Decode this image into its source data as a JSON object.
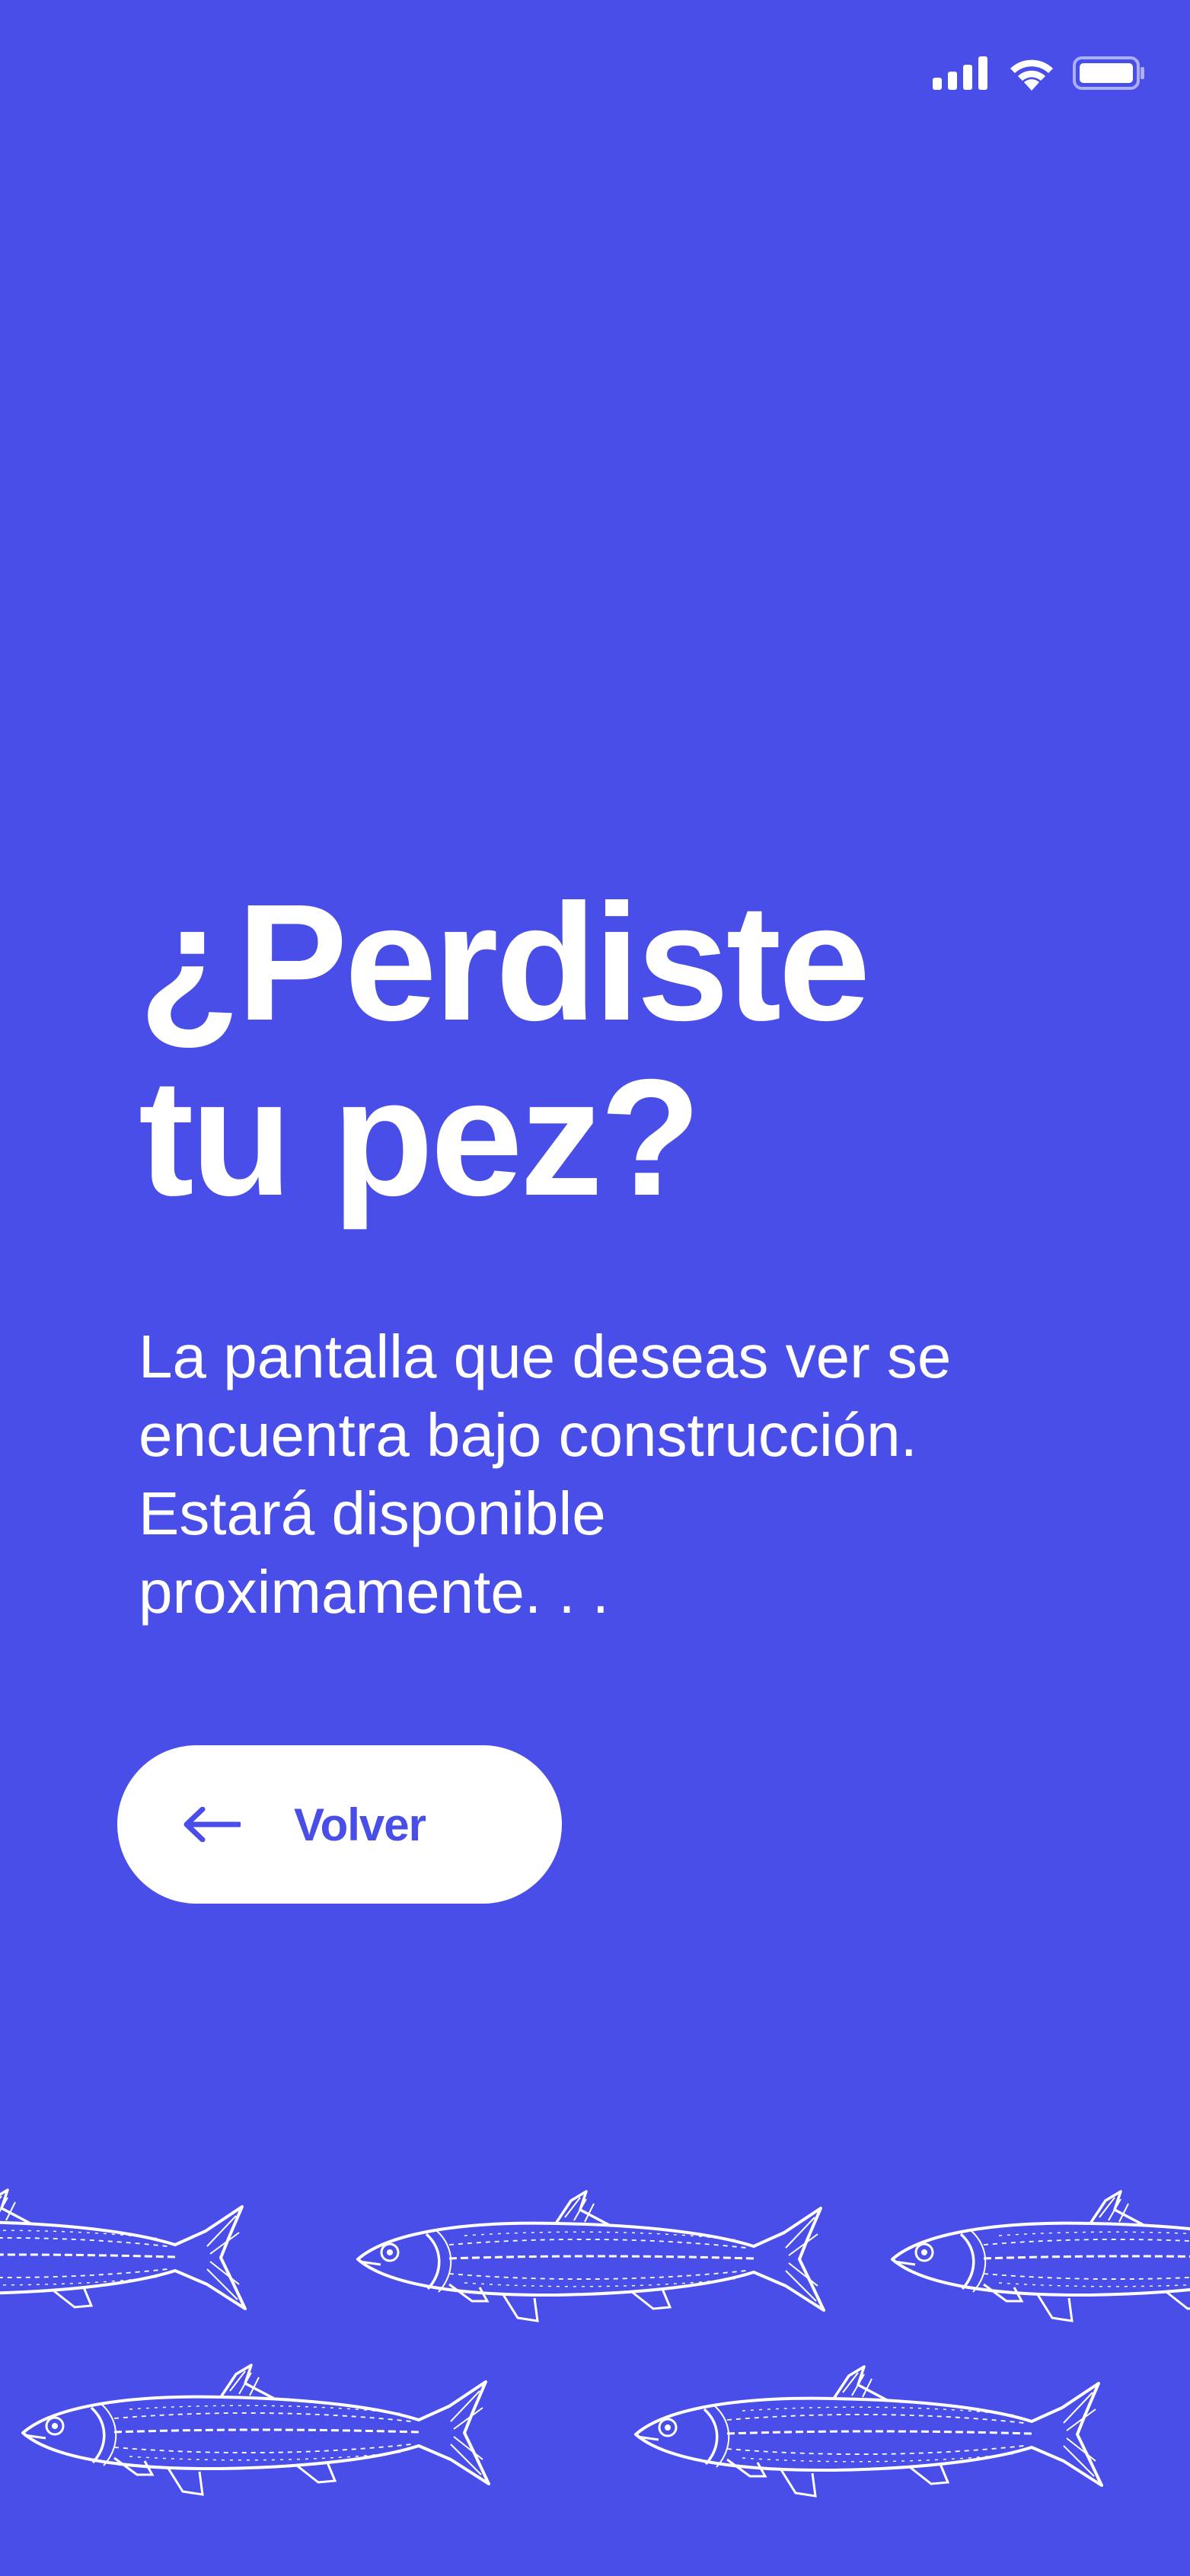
{
  "status_bar": {
    "signal_icon": "cellular-signal-icon",
    "wifi_icon": "wifi-icon",
    "battery_icon": "battery-icon"
  },
  "content": {
    "title_line1": "¿Perdiste",
    "title_line2": "tu pez?",
    "message_lines": [
      "La pantalla que deseas ver se",
      "encuentra bajo construcción.",
      "Estará disponible",
      "proximamente. . ."
    ]
  },
  "back_button": {
    "label": "Volver",
    "icon": "arrow-left-icon"
  },
  "decoration": {
    "icon": "fish-illustration-icon"
  },
  "colors": {
    "background": "#4a4ee8",
    "foreground": "#ffffff",
    "accent": "#4a4ee8"
  }
}
